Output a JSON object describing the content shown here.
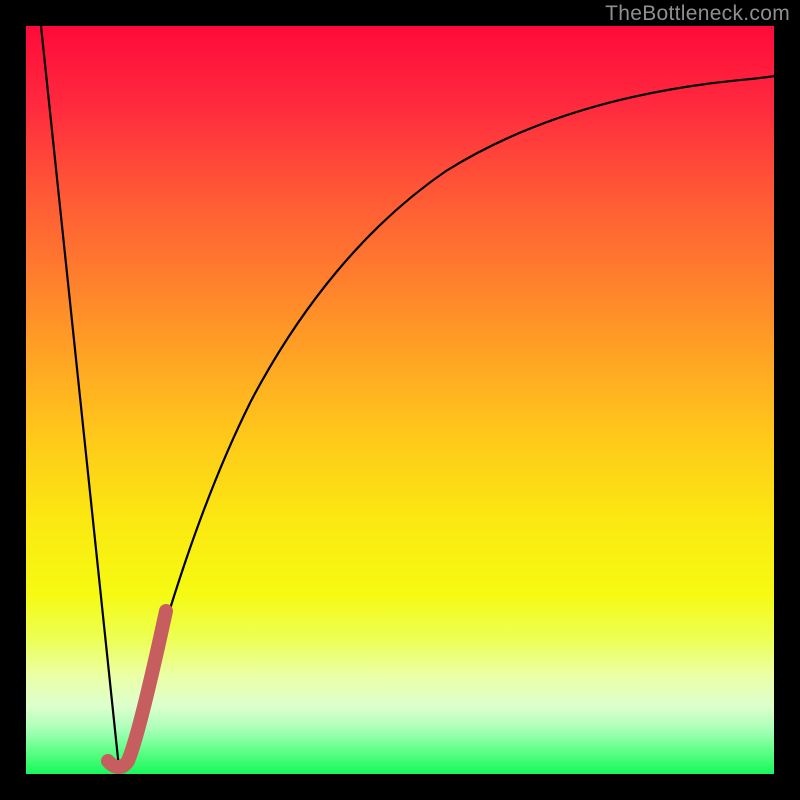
{
  "watermark": "TheBottleneck.com",
  "chart_data": {
    "type": "line",
    "title": "",
    "xlabel": "",
    "ylabel": "",
    "xlim": [
      0,
      100
    ],
    "ylim": [
      0,
      100
    ],
    "grid": false,
    "series": [
      {
        "name": "bottleneck-black-curve",
        "color": "#000000",
        "x": [
          0,
          12,
          14,
          18,
          22,
          27,
          33,
          40,
          48,
          57,
          68,
          80,
          92,
          100
        ],
        "y": [
          100,
          0,
          6,
          22,
          36,
          48,
          58,
          67,
          74,
          80,
          85,
          88.5,
          90.8,
          92
        ]
      },
      {
        "name": "highlight-segment",
        "color": "#c65d5f",
        "x": [
          11.2,
          12.5,
          13.5,
          15,
          16.5,
          18
        ],
        "y": [
          1,
          0.5,
          4,
          10,
          17,
          23
        ]
      }
    ]
  }
}
